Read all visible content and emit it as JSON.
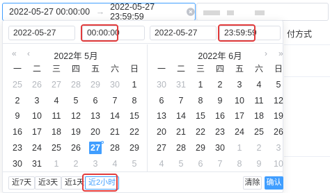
{
  "range_input": {
    "start": "2022-05-27 00:00:00",
    "separator": "→",
    "end": "2022-05-27 23:59:59"
  },
  "background": {
    "column_label": "付方式"
  },
  "header": {
    "start_date": "2022-05-27",
    "start_time": "00:00:00",
    "end_date": "2022-05-27",
    "end_time": "23:59:59"
  },
  "left_panel": {
    "title": "2022年 5月",
    "prev_year": "«",
    "prev_month": "‹",
    "weekdays": [
      "一",
      "二",
      "三",
      "四",
      "五",
      "六",
      "日"
    ],
    "weeks": [
      [
        {
          "d": "25",
          "o": true
        },
        {
          "d": "26",
          "o": true
        },
        {
          "d": "27",
          "o": true
        },
        {
          "d": "28",
          "o": true
        },
        {
          "d": "29",
          "o": true
        },
        {
          "d": "30",
          "o": true
        },
        {
          "d": "1"
        }
      ],
      [
        {
          "d": "2"
        },
        {
          "d": "3"
        },
        {
          "d": "4"
        },
        {
          "d": "5"
        },
        {
          "d": "6"
        },
        {
          "d": "7"
        },
        {
          "d": "8"
        }
      ],
      [
        {
          "d": "9"
        },
        {
          "d": "10"
        },
        {
          "d": "11"
        },
        {
          "d": "12"
        },
        {
          "d": "13"
        },
        {
          "d": "14"
        },
        {
          "d": "15"
        }
      ],
      [
        {
          "d": "16"
        },
        {
          "d": "17"
        },
        {
          "d": "18"
        },
        {
          "d": "19"
        },
        {
          "d": "20"
        },
        {
          "d": "21"
        },
        {
          "d": "22"
        }
      ],
      [
        {
          "d": "23"
        },
        {
          "d": "24"
        },
        {
          "d": "25"
        },
        {
          "d": "26"
        },
        {
          "d": "27",
          "today": true
        },
        {
          "d": "28"
        },
        {
          "d": "29"
        }
      ],
      [
        {
          "d": "30"
        },
        {
          "d": "31"
        },
        {
          "d": "1",
          "o": true
        },
        {
          "d": "2",
          "o": true
        },
        {
          "d": "3",
          "o": true
        },
        {
          "d": "4",
          "o": true
        },
        {
          "d": "5",
          "o": true
        }
      ]
    ]
  },
  "right_panel": {
    "title": "2022年 6月",
    "next_month": "›",
    "next_year": "»",
    "weekdays": [
      "一",
      "二",
      "三",
      "四",
      "五",
      "六",
      "日"
    ],
    "weeks": [
      [
        {
          "d": "30",
          "o": true
        },
        {
          "d": "31",
          "o": true
        },
        {
          "d": "1"
        },
        {
          "d": "2"
        },
        {
          "d": "3"
        },
        {
          "d": "4"
        },
        {
          "d": "5"
        }
      ],
      [
        {
          "d": "6"
        },
        {
          "d": "7"
        },
        {
          "d": "8"
        },
        {
          "d": "9"
        },
        {
          "d": "10"
        },
        {
          "d": "11"
        },
        {
          "d": "12"
        }
      ],
      [
        {
          "d": "13"
        },
        {
          "d": "14"
        },
        {
          "d": "15"
        },
        {
          "d": "16"
        },
        {
          "d": "17"
        },
        {
          "d": "18"
        },
        {
          "d": "19"
        }
      ],
      [
        {
          "d": "20"
        },
        {
          "d": "21"
        },
        {
          "d": "22"
        },
        {
          "d": "23"
        },
        {
          "d": "24"
        },
        {
          "d": "25"
        },
        {
          "d": "26"
        }
      ],
      [
        {
          "d": "27"
        },
        {
          "d": "28"
        },
        {
          "d": "29"
        },
        {
          "d": "30"
        },
        {
          "d": "1",
          "o": true
        },
        {
          "d": "2",
          "o": true
        },
        {
          "d": "3",
          "o": true
        }
      ],
      [
        {
          "d": "4",
          "o": true
        },
        {
          "d": "5",
          "o": true
        },
        {
          "d": "6",
          "o": true
        },
        {
          "d": "7",
          "o": true
        },
        {
          "d": "8",
          "o": true
        },
        {
          "d": "9",
          "o": true
        },
        {
          "d": "10",
          "o": true
        }
      ]
    ]
  },
  "footer": {
    "shortcuts": [
      "近7天",
      "近3天",
      "近1天",
      "近2小时"
    ],
    "clear_label": "清除",
    "confirm_label": "确认"
  },
  "colors": {
    "accent": "#409eff",
    "highlight": "#e23b3b",
    "muted": "#b4b8be"
  }
}
